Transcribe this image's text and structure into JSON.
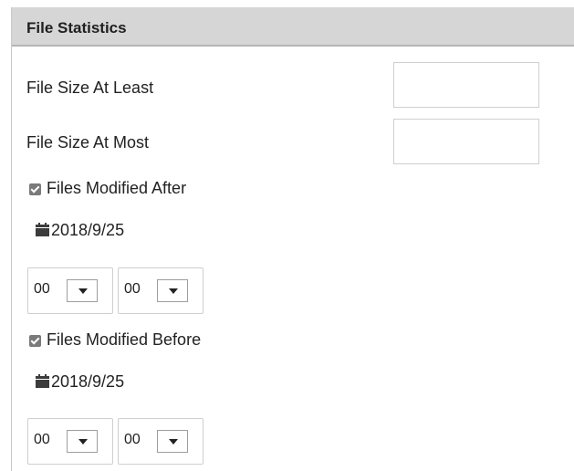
{
  "panel": {
    "title": "File Statistics"
  },
  "size_at_least": {
    "label": "File Size At Least",
    "value": ""
  },
  "size_at_most": {
    "label": "File Size At Most",
    "value": ""
  },
  "modified_after": {
    "checkbox_label": "Files Modified After",
    "checked": true,
    "date": "2018/9/25",
    "hour": "00",
    "minute": "00"
  },
  "modified_before": {
    "checkbox_label": "Files Modified Before",
    "checked": true,
    "date": "2018/9/25",
    "hour": "00",
    "minute": "00"
  },
  "icons": {
    "calendar": "calendar-icon",
    "dropdown": "chevron-down-icon",
    "checkbox": "checkbox-checked"
  },
  "colors": {
    "header_bg": "#d6d6d6",
    "checkbox_fill": "#7a7a7a",
    "border": "#cfcfcf"
  }
}
